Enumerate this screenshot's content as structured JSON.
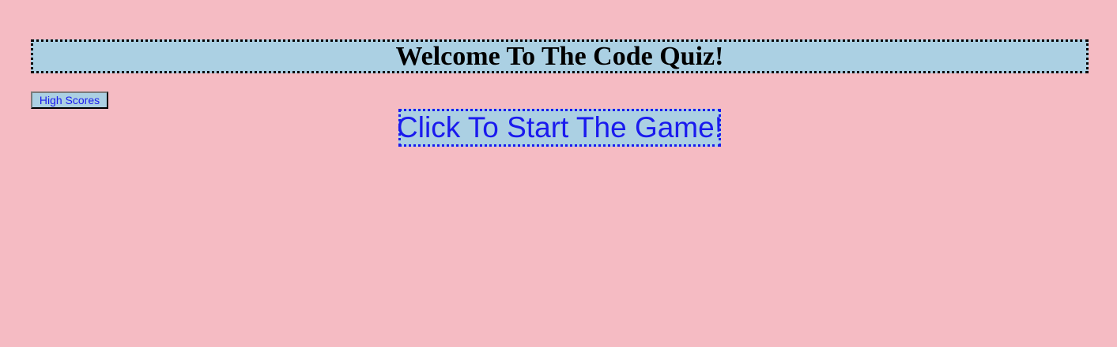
{
  "header": {
    "title": "Welcome To The Code Quiz!"
  },
  "nav": {
    "high_scores_label": "High Scores"
  },
  "main": {
    "start_label": "Click To Start The Game!"
  },
  "colors": {
    "page_background": "#f5bbc3",
    "panel_background": "#abd0e3",
    "link_text": "#1a1aee",
    "title_text": "#000000"
  }
}
